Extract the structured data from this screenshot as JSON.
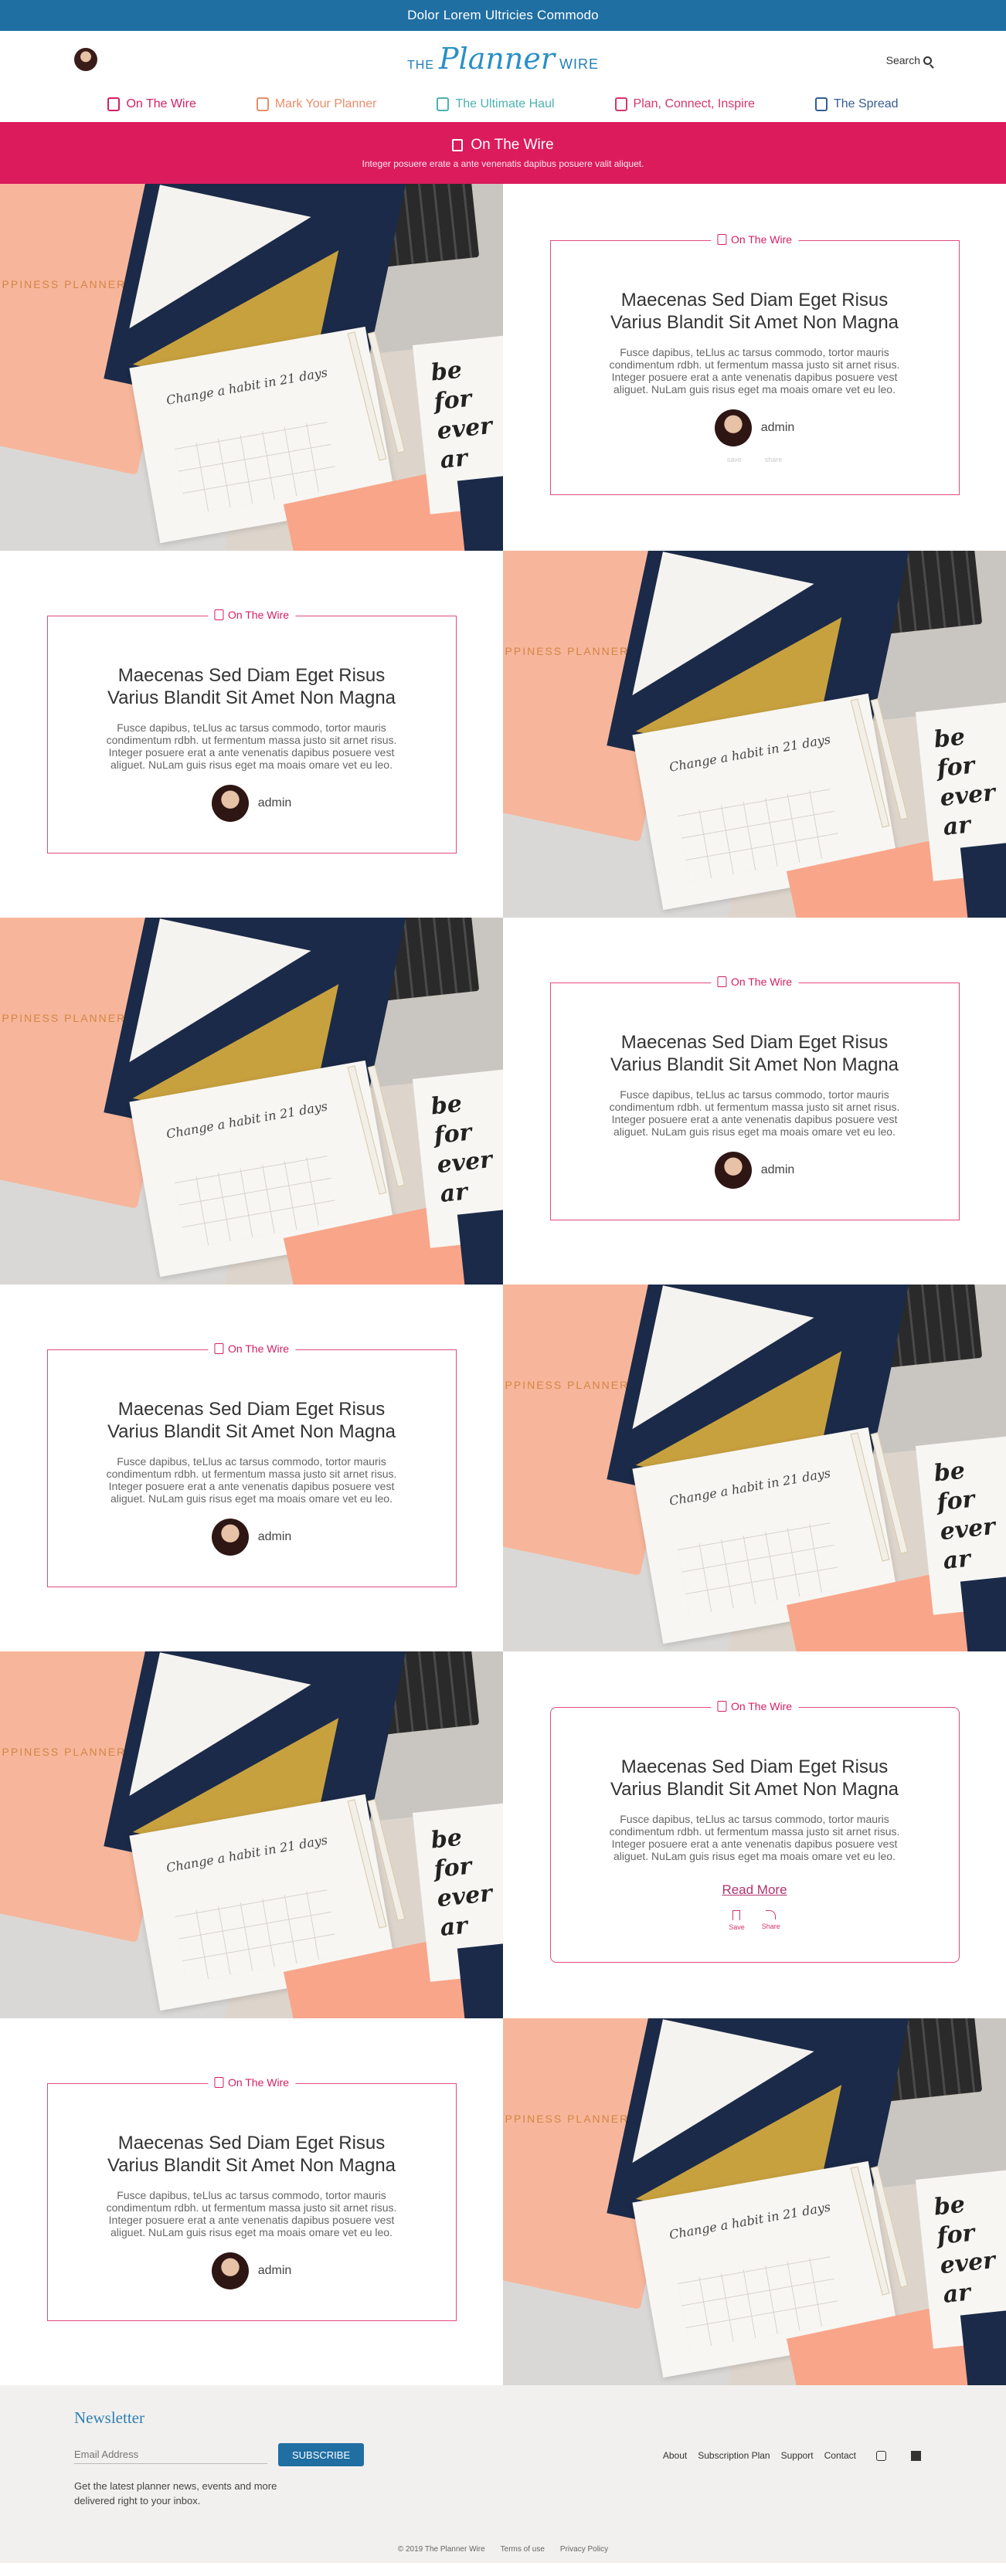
{
  "topbar": {
    "text": "Dolor Lorem Ultricies Commodo"
  },
  "header": {
    "logo": {
      "the": "THE",
      "planner": "Planner",
      "wire": "WIRE"
    },
    "search_label": "Search"
  },
  "nav": {
    "items": [
      {
        "label": "On The Wire",
        "icon": "wire-icon",
        "color": "#d41f63"
      },
      {
        "label": "Mark Your Planner",
        "icon": "planner-icon",
        "color": "#e98d6a"
      },
      {
        "label": "The Ultimate Haul",
        "icon": "bag-icon",
        "color": "#4bb3b0"
      },
      {
        "label": "Plan, Connect, Inspire",
        "icon": "heart-icon",
        "color": "#d4356d"
      },
      {
        "label": "The Spread",
        "icon": "notebook-icon",
        "color": "#355d93"
      }
    ]
  },
  "banner": {
    "title": "On The Wire",
    "subtitle": "Integer posuere erate a ante venenatis dapibus posuere valit aliquet."
  },
  "posts": [
    {
      "category": "On The Wire",
      "title": "Maecenas Sed Diam Eget Risus Varius Blandit Sit Amet Non Magna",
      "excerpt": "Fusce dapibus, teLlus ac tarsus commodo, tortor mauris condimentum rdbh. ut fermentum massa justo sit arnet risus. Integer posuere erat a ante venenatis dapibus posuere vest aliguet. NuLam guis risus eget ma moais omare vet eu leo.",
      "author": "admin",
      "save": "save",
      "share": "share"
    },
    {
      "category": "On The Wire",
      "title": "Maecenas Sed Diam Eget Risus Varius Blandit Sit Amet Non Magna",
      "excerpt": "Fusce dapibus, teLlus ac tarsus commodo, tortor mauris condimentum rdbh. ut fermentum massa justo sit arnet risus. Integer posuere erat a ante venenatis dapibus posuere vest aliguet. NuLam guis risus eget ma moais omare vet eu leo.",
      "author": "admin"
    },
    {
      "category": "On The Wire",
      "title": "Maecenas Sed Diam Eget Risus Varius Blandit Sit Amet Non Magna",
      "excerpt": "Fusce dapibus, teLlus ac tarsus commodo, tortor mauris condimentum rdbh. ut fermentum massa justo sit arnet risus. Integer posuere erat a ante venenatis dapibus posuere vest aliguet. NuLam guis risus eget ma moais omare vet eu leo.",
      "author": "admin"
    },
    {
      "category": "On The Wire",
      "title": "Maecenas Sed Diam Eget Risus Varius Blandit Sit Amet Non Magna",
      "excerpt": "Fusce dapibus, teLlus ac tarsus commodo, tortor mauris condimentum rdbh. ut fermentum massa justo sit arnet risus. Integer posuere erat a ante venenatis dapibus posuere vest aliguet. NuLam guis risus eget ma moais omare vet eu leo.",
      "author": "admin"
    },
    {
      "category": "On The Wire",
      "title": "Maecenas Sed Diam Eget Risus Varius Blandit Sit Amet Non Magna",
      "excerpt": "Fusce dapibus, teLlus ac tarsus commodo, tortor mauris condimentum rdbh. ut fermentum massa justo sit arnet risus. Integer posuere erat a ante venenatis dapibus posuere vest aliguet. NuLam guis risus eget ma moais omare vet eu leo.",
      "read_more": "Read More",
      "save": "Save",
      "share": "Share"
    },
    {
      "category": "On The Wire",
      "title": "Maecenas Sed Diam Eget Risus Varius Blandit Sit Amet Non Magna",
      "excerpt": "Fusce dapibus, teLlus ac tarsus commodo, tortor mauris condimentum rdbh. ut fermentum massa justo sit arnet risus. Integer posuere erat a ante venenatis dapibus posuere vest aliguet. NuLam guis risus eget ma moais omare vet eu leo.",
      "author": "admin"
    }
  ],
  "footer": {
    "newsletter_title": "Newsletter",
    "email_placeholder": "Email Address",
    "subscribe_label": "SUBSCRIBE",
    "newsletter_desc": "Get the latest planner news, events and more delivered right to your inbox.",
    "links": [
      "About",
      "Subscription Plan",
      "Support",
      "Contact"
    ],
    "social": [
      "instagram-icon",
      "facebook-icon"
    ],
    "copyright": "© 2019 The Planner Wire",
    "terms": "Terms of use",
    "privacy": "Privacy Policy"
  },
  "colors": {
    "blue": "#1f6fa3",
    "pink": "#dc1b5d",
    "border_pink": "#e24a82"
  }
}
